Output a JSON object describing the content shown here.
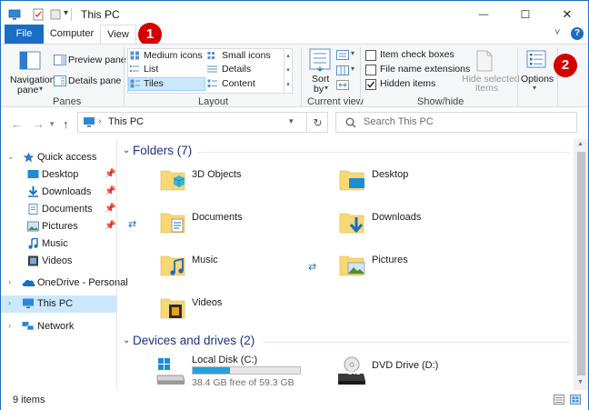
{
  "window": {
    "title": "This PC"
  },
  "title_bar": {
    "minimize": "—",
    "maximize": "☐",
    "close": "✕",
    "qa_dropdown": "▾"
  },
  "tabs": {
    "file": "File",
    "computer": "Computer",
    "view": "View"
  },
  "badges": {
    "one": "1",
    "two": "2"
  },
  "ribbon": {
    "help": "?",
    "expand": "˅",
    "panes": {
      "label": "Panes",
      "navigation_pane": "Navigation",
      "navigation_pane_2": "pane",
      "preview_pane": "Preview pane",
      "details_pane": "Details pane"
    },
    "layout": {
      "label": "Layout",
      "items": [
        "Medium icons",
        "Small icons",
        "List",
        "Details",
        "Tiles",
        "Content"
      ]
    },
    "current_view": {
      "label": "Current view",
      "sort": "Sort",
      "sort_2": "by"
    },
    "show_hide": {
      "label": "Show/hide",
      "item_check_boxes": "Item check boxes",
      "file_name_extensions": "File name extensions",
      "hidden_items": "Hidden items",
      "hide_selected": "Hide selected",
      "hide_selected_2": "items"
    },
    "options": "Options"
  },
  "address": {
    "path": "This PC",
    "search_placeholder": "Search This PC"
  },
  "nav": {
    "quick_access": "Quick access",
    "items": [
      "Desktop",
      "Downloads",
      "Documents",
      "Pictures",
      "Music",
      "Videos"
    ],
    "onedrive": "OneDrive - Personal",
    "this_pc": "This PC",
    "network": "Network"
  },
  "folders": {
    "heading": "Folders (7)",
    "items": [
      "3D Objects",
      "Desktop",
      "Documents",
      "Downloads",
      "Music",
      "Pictures",
      "Videos"
    ]
  },
  "drives": {
    "heading": "Devices and drives (2)",
    "local": {
      "name": "Local Disk (C:)",
      "free": "38.4 GB free of 59.3 GB",
      "used_fraction": 0.35
    },
    "dvd": {
      "name": "DVD Drive (D:)",
      "badge": "DVD"
    }
  },
  "status": {
    "count": "9 items"
  },
  "colors": {
    "accent": "#1a6dc4",
    "badge": "#d40000",
    "selection": "#cce8ff",
    "folder": "#f8d775"
  }
}
